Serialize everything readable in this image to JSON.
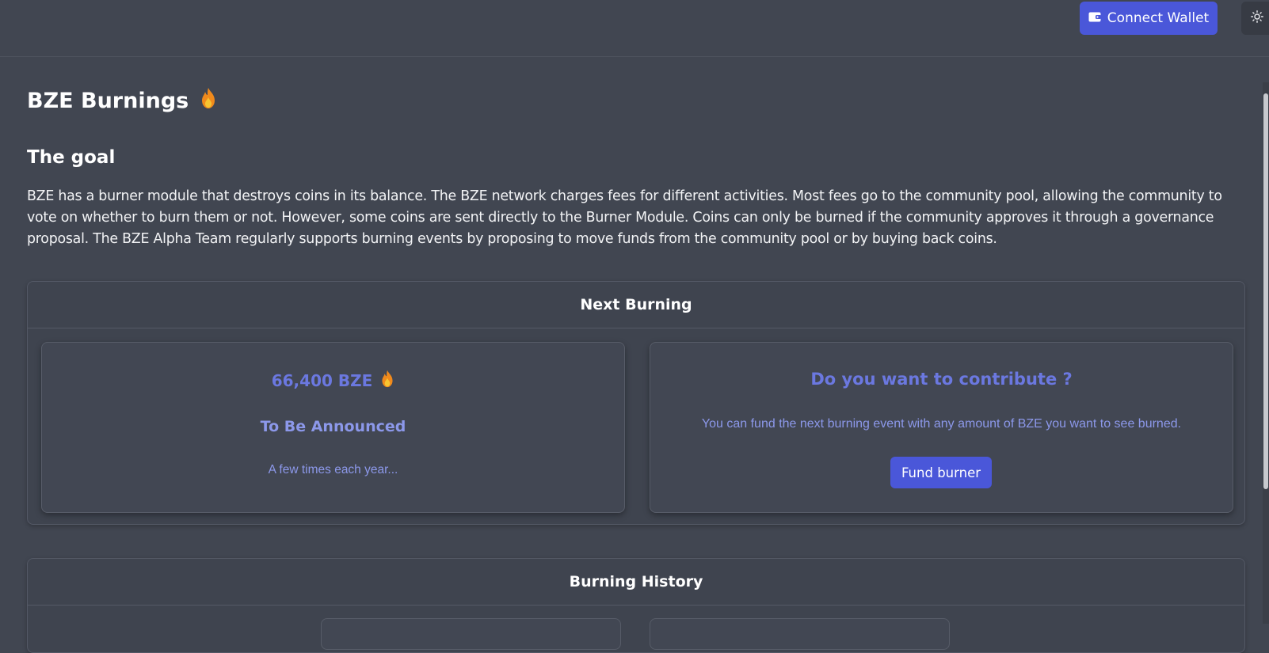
{
  "header": {
    "connect_wallet_label": "Connect Wallet",
    "wallet_icon": "wallet-icon",
    "theme_icon": "sun-icon",
    "accent_color": "#4a57d9"
  },
  "page": {
    "title": "BZE Burnings",
    "title_icon": "flame-icon"
  },
  "goal": {
    "title": "The goal",
    "text": "BZE has a burner module that destroys coins in its balance. The BZE network charges fees for different activities. Most fees go to the community pool, allowing the community to vote on whether to burn them or not. However, some coins are sent directly to the Burner Module. Coins can only be burned if the community approves it through a governance proposal. The BZE Alpha Team regularly supports burning events by proposing to move funds from the community pool or by buying back coins."
  },
  "next_burning": {
    "title": "Next Burning",
    "amount": "66,400 BZE",
    "amount_icon": "flame-icon",
    "date": "To Be Announced",
    "frequency": "A few times each year...",
    "contribute_title": "Do you want to contribute ?",
    "contribute_text": "You can fund the next burning event with any amount of BZE you want to see burned.",
    "fund_button_label": "Fund burner"
  },
  "burning_history": {
    "title": "Burning History"
  }
}
